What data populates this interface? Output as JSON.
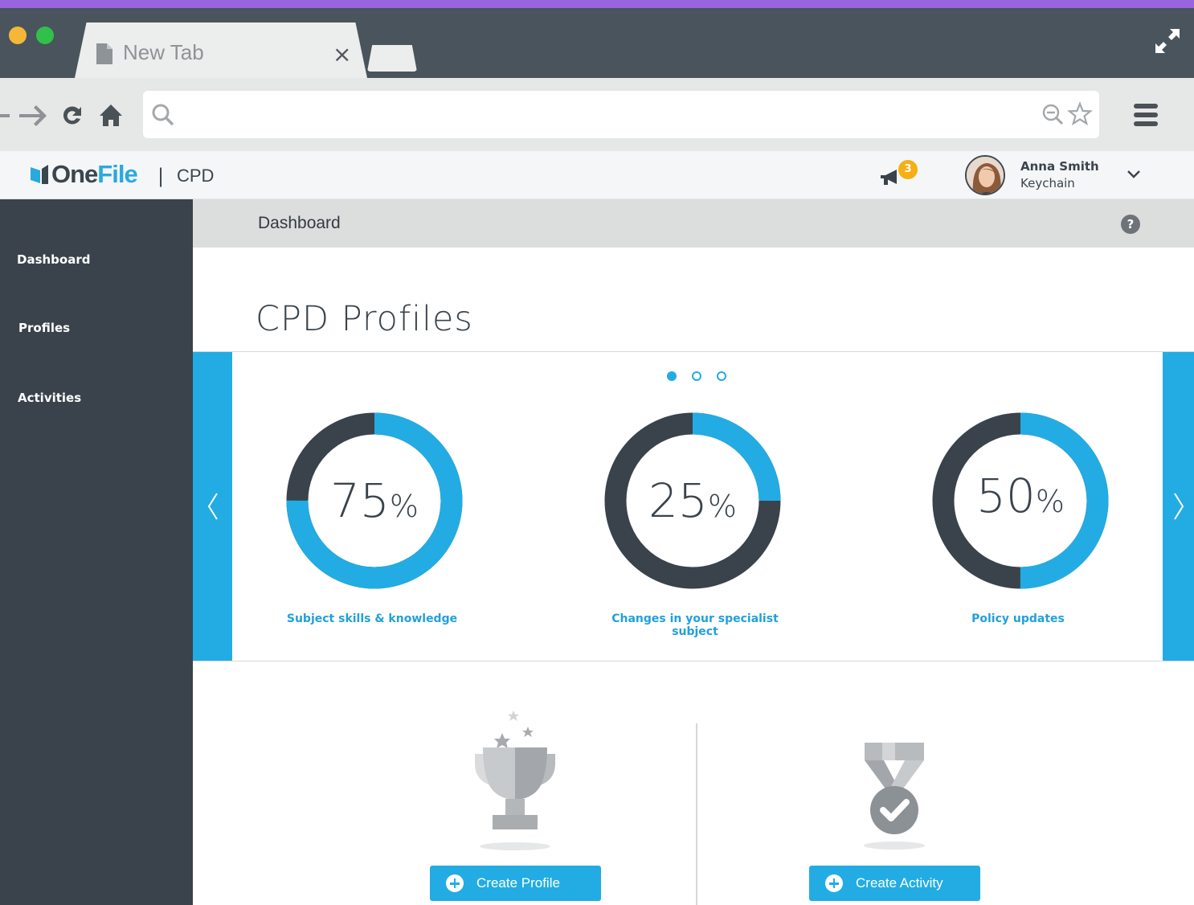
{
  "browser": {
    "tab_title": "New Tab",
    "tab_close": "×",
    "address_value": "",
    "colors": {
      "chrome": "#49545c",
      "toolbar": "#e6e7e7",
      "top_strip": "#9a63e0"
    }
  },
  "app": {
    "logo": {
      "text_dark": "One",
      "text_accent": "File"
    },
    "logo_separator": "|",
    "section": "CPD",
    "notifications": {
      "count": "3",
      "icon": "megaphone-icon"
    },
    "user": {
      "name": "Anna Smith",
      "organisation": "Keychain"
    },
    "accent_color": "#22ace3"
  },
  "sidebar": {
    "items": [
      {
        "label": "Dashboard"
      },
      {
        "label": "Profiles"
      },
      {
        "label": "Activities"
      }
    ]
  },
  "breadcrumb": {
    "current": "Dashboard",
    "help": "?"
  },
  "main": {
    "title": "CPD Profiles",
    "carousel": {
      "page_count": 3,
      "active_page": 1,
      "profiles": [
        {
          "percent": 75,
          "value_text": "75",
          "unit": "%",
          "label": "Subject skills & knowledge"
        },
        {
          "percent": 25,
          "value_text": "25",
          "unit": "%",
          "label": "Changes in your specialist subject"
        },
        {
          "percent": 50,
          "value_text": "50",
          "unit": "%",
          "label": "Policy updates"
        }
      ]
    },
    "actions": [
      {
        "label": "Create Profile",
        "icon": "trophy-icon"
      },
      {
        "label": "Create Activity",
        "icon": "medal-icon"
      }
    ]
  }
}
